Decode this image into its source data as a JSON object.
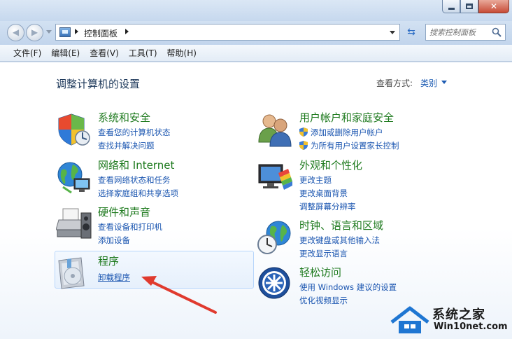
{
  "addressbar": {
    "breadcrumb": "控制面板",
    "search_placeholder": "搜索控制面板"
  },
  "menubar": {
    "items": [
      "文件(F)",
      "编辑(E)",
      "查看(V)",
      "工具(T)",
      "帮助(H)"
    ]
  },
  "content": {
    "title": "调整计算机的设置",
    "view_by_label": "查看方式:",
    "view_by_value": "类别",
    "categories": [
      {
        "title": "系统和安全",
        "links": [
          "查看您的计算机状态",
          "查找并解决问题"
        ]
      },
      {
        "title": "网络和 Internet",
        "links": [
          "查看网络状态和任务",
          "选择家庭组和共享选项"
        ]
      },
      {
        "title": "硬件和声音",
        "links": [
          "查看设备和打印机",
          "添加设备"
        ]
      },
      {
        "title": "程序",
        "links": [
          "卸载程序"
        ]
      },
      {
        "title": "用户帐户和家庭安全",
        "links": [
          "添加或删除用户帐户",
          "为所有用户设置家长控制"
        ]
      },
      {
        "title": "外观和个性化",
        "links": [
          "更改主题",
          "更改桌面背景",
          "调整屏幕分辨率"
        ]
      },
      {
        "title": "时钟、语言和区域",
        "links": [
          "更改键盘或其他输入法",
          "更改显示语言"
        ]
      },
      {
        "title": "轻松访问",
        "links": [
          "使用 Windows 建议的设置",
          "优化视频显示"
        ]
      }
    ]
  },
  "watermark": {
    "title": "系统之家",
    "url": "Win10net.com"
  },
  "colors": {
    "link": "#1a55b0",
    "category_title": "#1e7a1e",
    "page_title": "#1e395b",
    "arrow": "#e03a2e"
  }
}
